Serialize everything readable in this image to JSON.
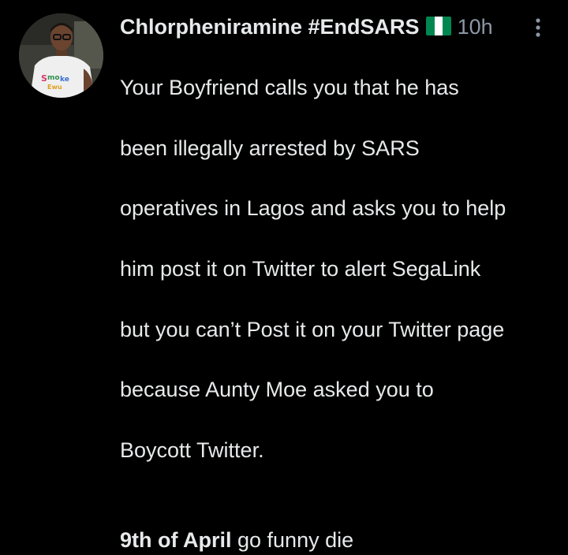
{
  "tweet": {
    "display_name": "Chlorpheniramine #EndSARS",
    "flag_icon": "nigeria-flag-icon",
    "flag_colors": {
      "green": "#008751",
      "white": "#ffffff"
    },
    "timestamp": "10h",
    "more_icon": "more-vertical-icon",
    "body_lines": [
      "Your Boyfriend calls you that he has",
      "been illegally arrested by SARS",
      "operatives in Lagos and asks you to help",
      "him post it on Twitter to alert SegaLink",
      "but you can’t Post it on your Twitter page",
      "because Aunty Moe asked you to",
      "Boycott Twitter."
    ],
    "final_bold": "9th of April",
    "final_rest": " go funny die"
  },
  "colors": {
    "background": "#000000",
    "text": "#e7e9ea",
    "muted": "#8b98a5"
  }
}
